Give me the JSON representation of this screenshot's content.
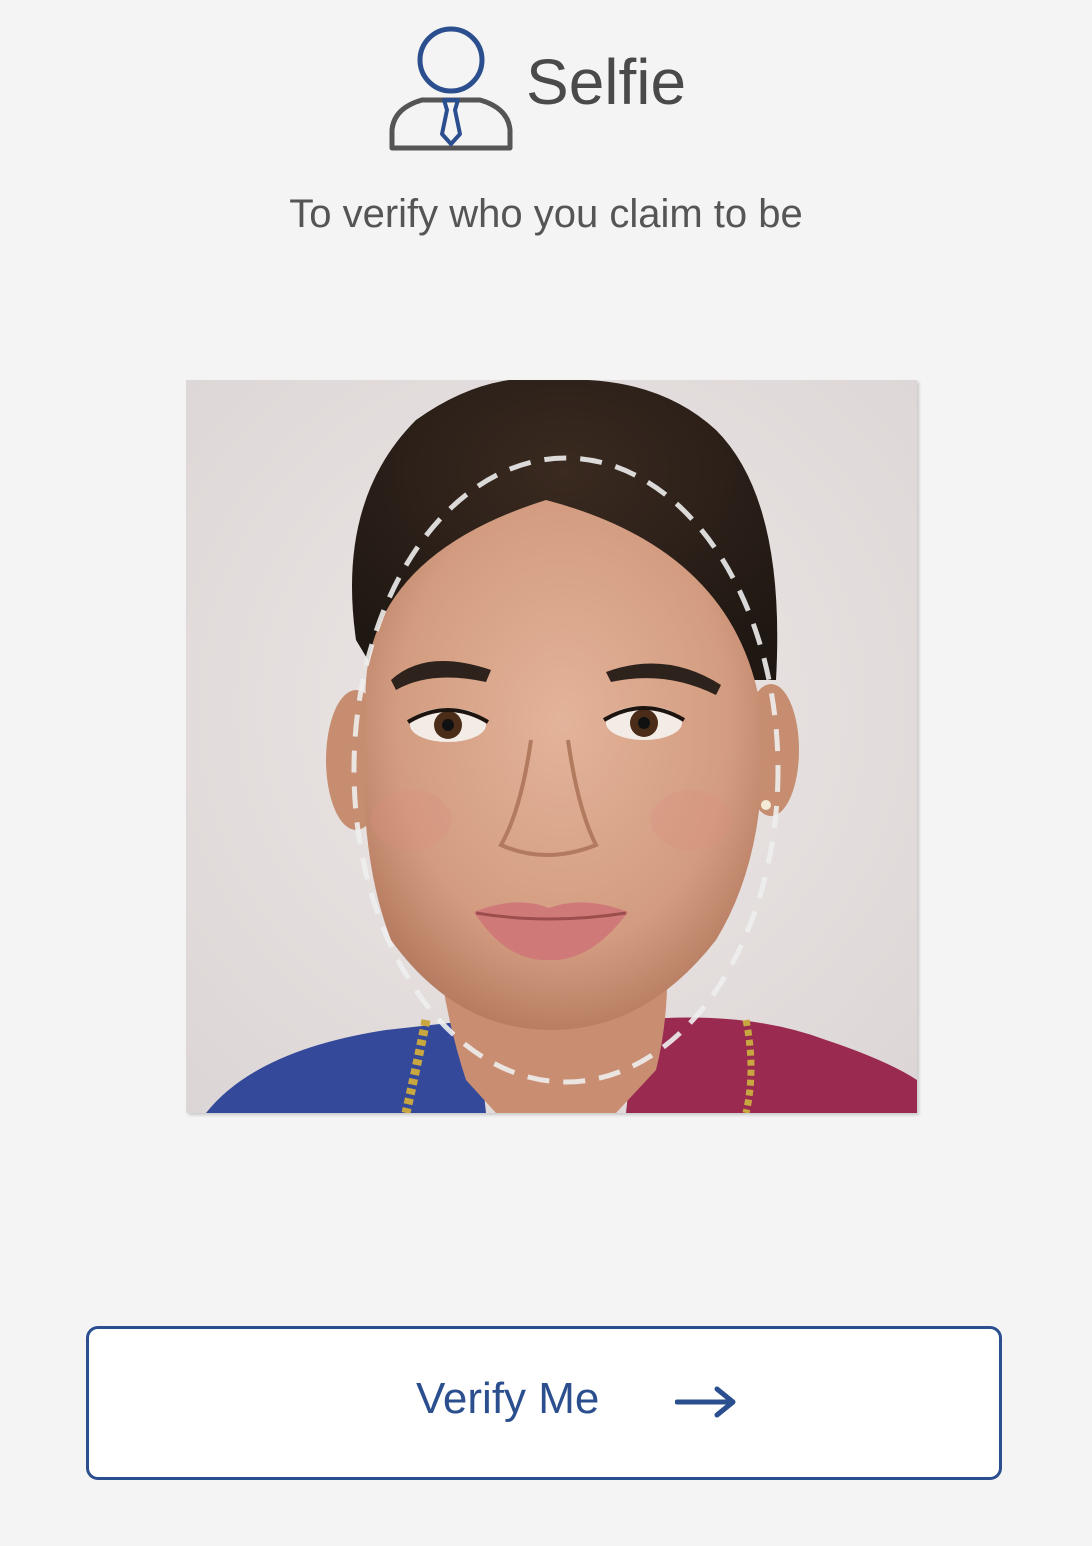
{
  "header": {
    "icon": "user-with-tie-icon",
    "title": "Selfie",
    "subtitle": "To verify who you claim to be"
  },
  "photo": {
    "content": "face-photo",
    "overlay": "face-guide-oval"
  },
  "action": {
    "label": "Verify Me",
    "icon": "arrow-right-icon"
  },
  "colors": {
    "background": "#f4f4f4",
    "accent": "#2b4f8e",
    "text": "#4a4a4a",
    "button_background": "#ffffff"
  }
}
